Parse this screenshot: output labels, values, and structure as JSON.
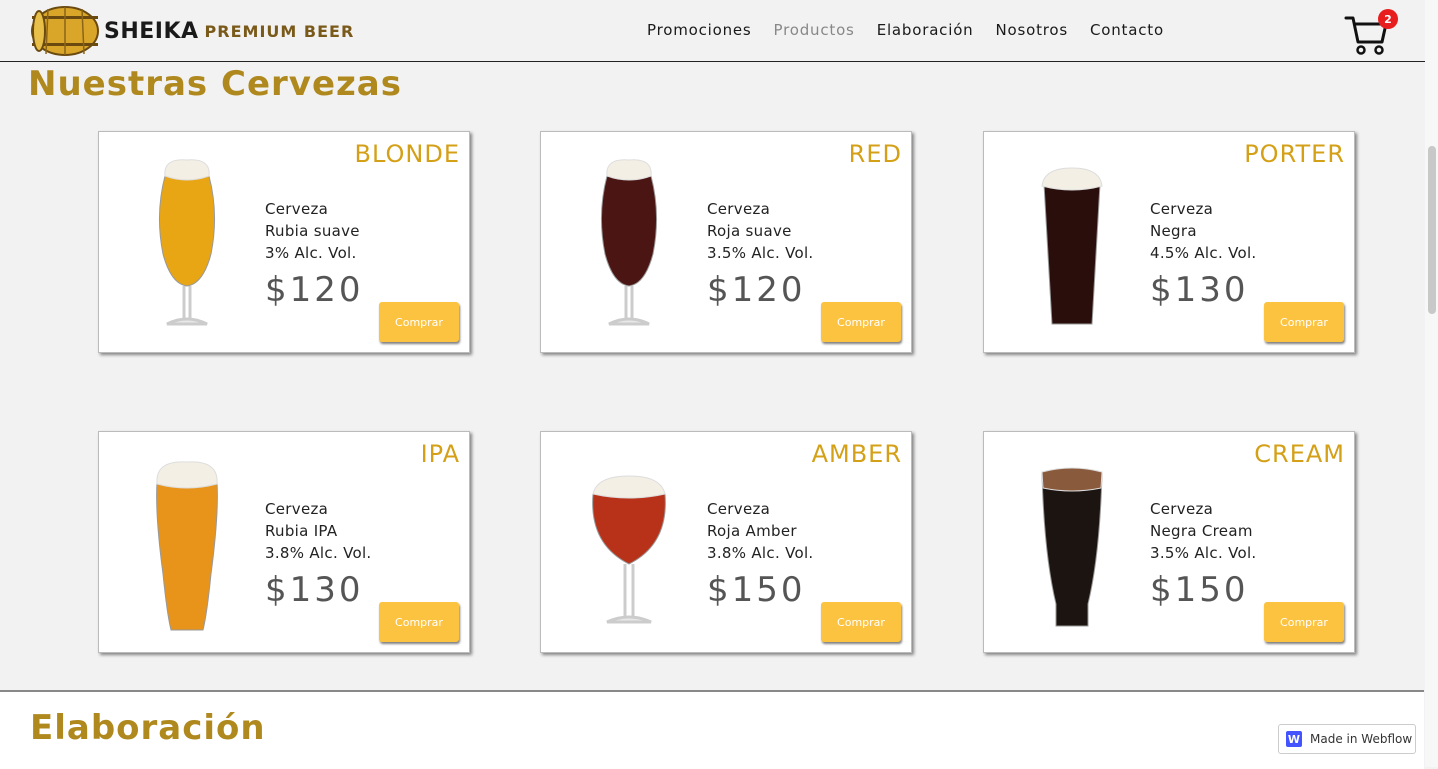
{
  "brand": {
    "name": "SHEIKA",
    "tagline": "PREMIUM BEER"
  },
  "nav": {
    "items": [
      "Promociones",
      "Productos",
      "Elaboración",
      "Nosotros",
      "Contacto"
    ],
    "current": "Productos"
  },
  "cart": {
    "count": "2"
  },
  "products_section": {
    "title": "Nuestras Cervezas"
  },
  "products": [
    {
      "name": "BLONDE",
      "line1": "Cerveza",
      "line2": "Rubia suave",
      "line3": "3% Alc. Vol.",
      "price": "$120",
      "button": "Comprar",
      "glass": "tulip",
      "color": "#e8a514"
    },
    {
      "name": "RED",
      "line1": "Cerveza",
      "line2": "Roja suave",
      "line3": "3.5% Alc. Vol.",
      "price": "$120",
      "button": "Comprar",
      "glass": "tulip",
      "color": "#4a1512"
    },
    {
      "name": "PORTER",
      "line1": "Cerveza",
      "line2": "Negra",
      "line3": "4.5% Alc. Vol.",
      "price": "$130",
      "button": "Comprar",
      "glass": "pint",
      "color": "#2a0e0c"
    },
    {
      "name": "IPA",
      "line1": "Cerveza",
      "line2": "Rubia IPA",
      "line3": "3.8% Alc. Vol.",
      "price": "$130",
      "button": "Comprar",
      "glass": "pilsner",
      "color": "#e8941a"
    },
    {
      "name": "AMBER",
      "line1": "Cerveza",
      "line2": "Roja Amber",
      "line3": "3.8% Alc. Vol.",
      "price": "$150",
      "button": "Comprar",
      "glass": "snifter",
      "color": "#b8321a"
    },
    {
      "name": "CREAM",
      "line1": "Cerveza",
      "line2": "Negra Cream",
      "line3": "3.5% Alc. Vol.",
      "price": "$150",
      "button": "Comprar",
      "glass": "tall",
      "color": "#1c1410"
    }
  ],
  "elaboration_section": {
    "title": "Elaboración"
  },
  "badge": {
    "label": "Made in Webflow"
  }
}
